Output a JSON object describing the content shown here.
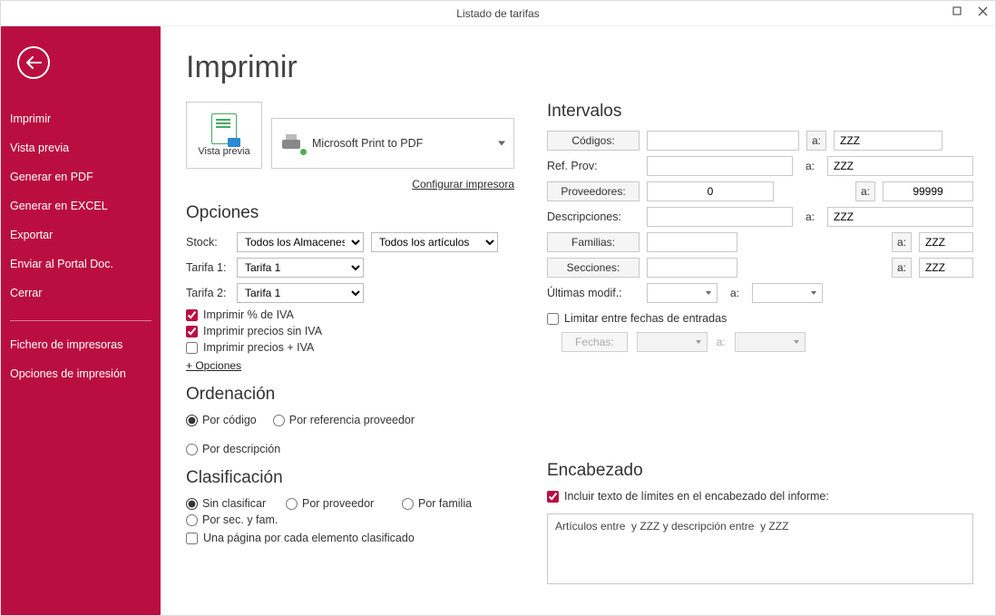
{
  "titlebar": {
    "title": "Listado de tarifas"
  },
  "sidebar": {
    "items": [
      "Imprimir",
      "Vista previa",
      "Generar en PDF",
      "Generar en EXCEL",
      "Exportar",
      "Enviar al Portal Doc.",
      "Cerrar"
    ],
    "items2": [
      "Fichero de impresoras",
      "Opciones de impresión"
    ]
  },
  "page": {
    "title": "Imprimir"
  },
  "preview": {
    "label": "Vista previa"
  },
  "printer": {
    "name": "Microsoft Print to PDF",
    "config": "Configurar impresora"
  },
  "sections": {
    "opciones": "Opciones",
    "ordenacion": "Ordenación",
    "clasificacion": "Clasificación",
    "intervalos": "Intervalos",
    "encabezado": "Encabezado"
  },
  "opciones": {
    "stock_label": "Stock:",
    "stock_value": "Todos los Almacenes",
    "stock_filter": "Todos los artículos",
    "tarifa1_label": "Tarifa 1:",
    "tarifa1_value": "Tarifa 1",
    "tarifa2_label": "Tarifa 2:",
    "tarifa2_value": "Tarifa 1",
    "chk_iva_pct": "Imprimir % de IVA",
    "chk_sin_iva": "Imprimir precios sin IVA",
    "chk_con_iva": "Imprimir precios + IVA",
    "more": "+ Opciones"
  },
  "ordenacion": {
    "por_codigo": "Por código",
    "por_ref": "Por referencia proveedor",
    "por_desc": "Por descripción"
  },
  "clasificacion": {
    "sin": "Sin clasificar",
    "prov": "Por proveedor",
    "fam": "Por familia",
    "sec": "Por sec. y fam.",
    "pagina": "Una página por cada elemento clasificado"
  },
  "intervalos": {
    "a": "a:",
    "codigos_label": "Códigos:",
    "codigos_from": "",
    "codigos_to": "ZZZ",
    "refprov_label": "Ref. Prov:",
    "refprov_from": "",
    "refprov_to": "ZZZ",
    "prov_label": "Proveedores:",
    "prov_from": "0",
    "prov_to": "99999",
    "desc_label": "Descripciones:",
    "desc_from": "",
    "desc_to": "ZZZ",
    "fam_label": "Familias:",
    "fam_from": "",
    "fam_to": "ZZZ",
    "sec_label": "Secciones:",
    "sec_from": "",
    "sec_to": "ZZZ",
    "ultimas_label": "Últimas modif.:",
    "limitar": "Limitar entre fechas de entradas",
    "fechas_btn": "Fechas:"
  },
  "encabezado": {
    "check": "Incluir texto de límites en el encabezado del informe:",
    "text": "Artículos entre  y ZZZ y descripción entre  y ZZZ"
  }
}
